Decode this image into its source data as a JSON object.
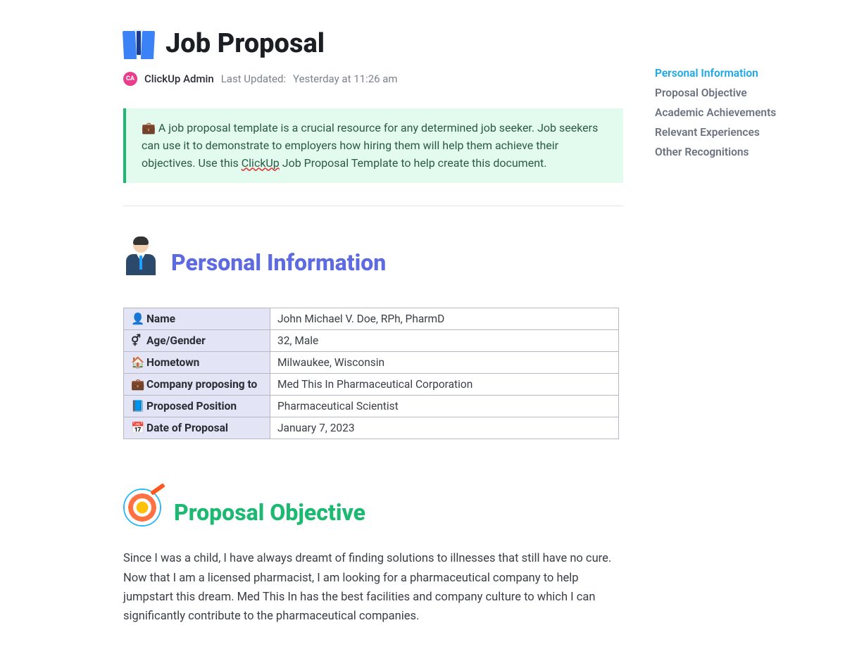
{
  "header": {
    "title": "Job Proposal",
    "avatar_initials": "CA",
    "author": "ClickUp Admin",
    "last_updated_label": "Last Updated:",
    "last_updated_value": "Yesterday at 11:26 am"
  },
  "callout": {
    "emoji": "💼",
    "text_before": "A job proposal template is a crucial resource for any determined job seeker. Job seekers can use it to demonstrate to employers how hiring them will help them achieve their objectives. Use this ",
    "link_text": "ClickUp",
    "text_after": " Job Proposal Template to help create this document."
  },
  "toc": [
    {
      "label": "Personal Information",
      "active": true
    },
    {
      "label": "Proposal Objective",
      "active": false
    },
    {
      "label": "Academic Achievements",
      "active": false
    },
    {
      "label": "Relevant Experiences",
      "active": false
    },
    {
      "label": "Other Recognitions",
      "active": false
    }
  ],
  "sections": {
    "personal_info": {
      "heading": "Personal Information",
      "rows": [
        {
          "emoji": "👤",
          "key": "Name",
          "value": "John Michael V. Doe, RPh, PharmD"
        },
        {
          "emoji": "⚥",
          "key": "Age/Gender",
          "value": "32, Male"
        },
        {
          "emoji": "🏠",
          "key": "Hometown",
          "value": "Milwaukee, Wisconsin"
        },
        {
          "emoji": "💼",
          "key": "Company proposing to",
          "value": "Med This In Pharmaceutical Corporation"
        },
        {
          "emoji": "📘",
          "key": "Proposed Position",
          "value": "Pharmaceutical Scientist"
        },
        {
          "emoji": "📅",
          "key": "Date of Proposal",
          "value": "January 7, 2023"
        }
      ]
    },
    "objective": {
      "heading": "Proposal Objective",
      "body": "Since I was a child, I have always dreamt of finding solutions to illnesses that still have no cure. Now that I am a licensed pharmacist, I am looking for a pharmaceutical company to help jumpstart this dream. Med This In has the best facilities and company culture to which I can significantly contribute to the pharmaceutical companies."
    }
  }
}
